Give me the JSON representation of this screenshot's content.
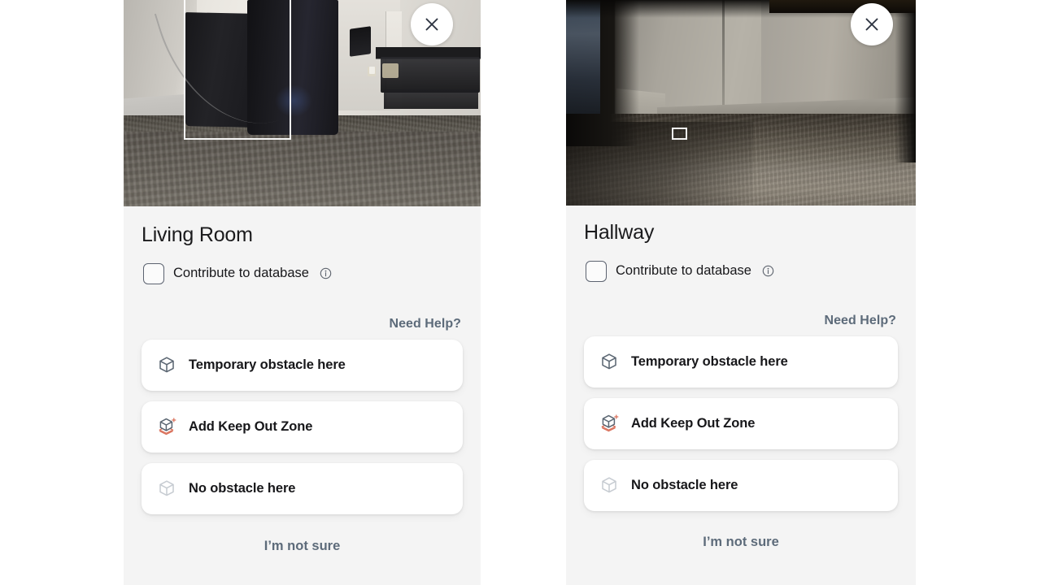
{
  "panels": [
    {
      "room_title": "Living Room",
      "close_icon": "close-icon",
      "detection_box": "object-bounding-box",
      "contribute": {
        "label": "Contribute to database",
        "checked": false,
        "info_icon": "info-circle-icon"
      },
      "need_help": "Need Help?",
      "options": [
        {
          "label": "Temporary obstacle here",
          "icon": "cube-icon"
        },
        {
          "label": "Add Keep Out Zone",
          "icon": "cube-add-keepout-icon"
        },
        {
          "label": "No obstacle here",
          "icon": "cube-outline-muted-icon"
        }
      ],
      "not_sure": "I’m not sure"
    },
    {
      "room_title": "Hallway",
      "close_icon": "close-icon",
      "detection_box": "object-bounding-box",
      "contribute": {
        "label": "Contribute to database",
        "checked": false,
        "info_icon": "info-circle-icon"
      },
      "need_help": "Need Help?",
      "options": [
        {
          "label": "Temporary obstacle here",
          "icon": "cube-icon"
        },
        {
          "label": "Add Keep Out Zone",
          "icon": "cube-add-keepout-icon"
        },
        {
          "label": "No obstacle here",
          "icon": "cube-outline-muted-icon"
        }
      ],
      "not_sure": "I’m not sure"
    }
  ],
  "colors": {
    "page_background": "#ffffff",
    "sheet_background": "#f4f4f4",
    "card_background": "#ffffff",
    "title_text": "#1b1b1d",
    "body_text": "#18181b",
    "link_text": "#5d6b7a",
    "cube_icon": "#5c6773",
    "cube_icon_muted": "#c7ccd2",
    "keepout_accent": "#d9705a",
    "checkbox_border": "#5c6370",
    "overlay_box": "#ffffff"
  }
}
